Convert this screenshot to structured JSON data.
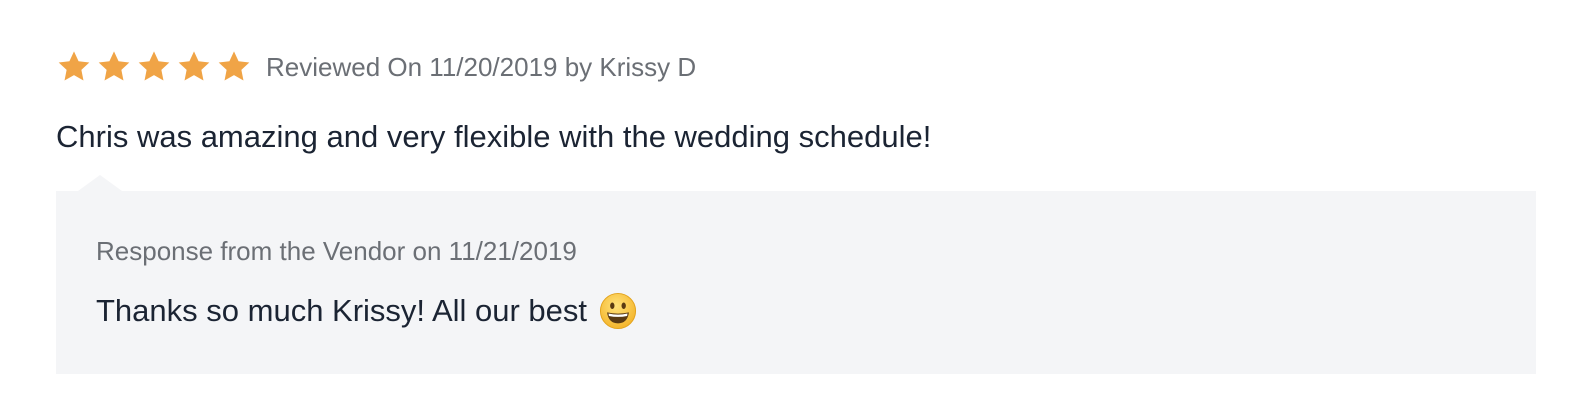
{
  "review": {
    "rating": 5,
    "rating_max": 5,
    "star_icon": "star-icon",
    "star_color": "#f0a446",
    "meta": "Reviewed On 11/20/2019 by Krissy D",
    "body": "Chris was amazing and very flexible with the wedding schedule!"
  },
  "response": {
    "meta": "Response from the Vendor on 11/21/2019",
    "body": "Thanks so much Krissy! All our best",
    "emoji_icon": "grinning-face-icon",
    "background": "#f4f5f7"
  }
}
